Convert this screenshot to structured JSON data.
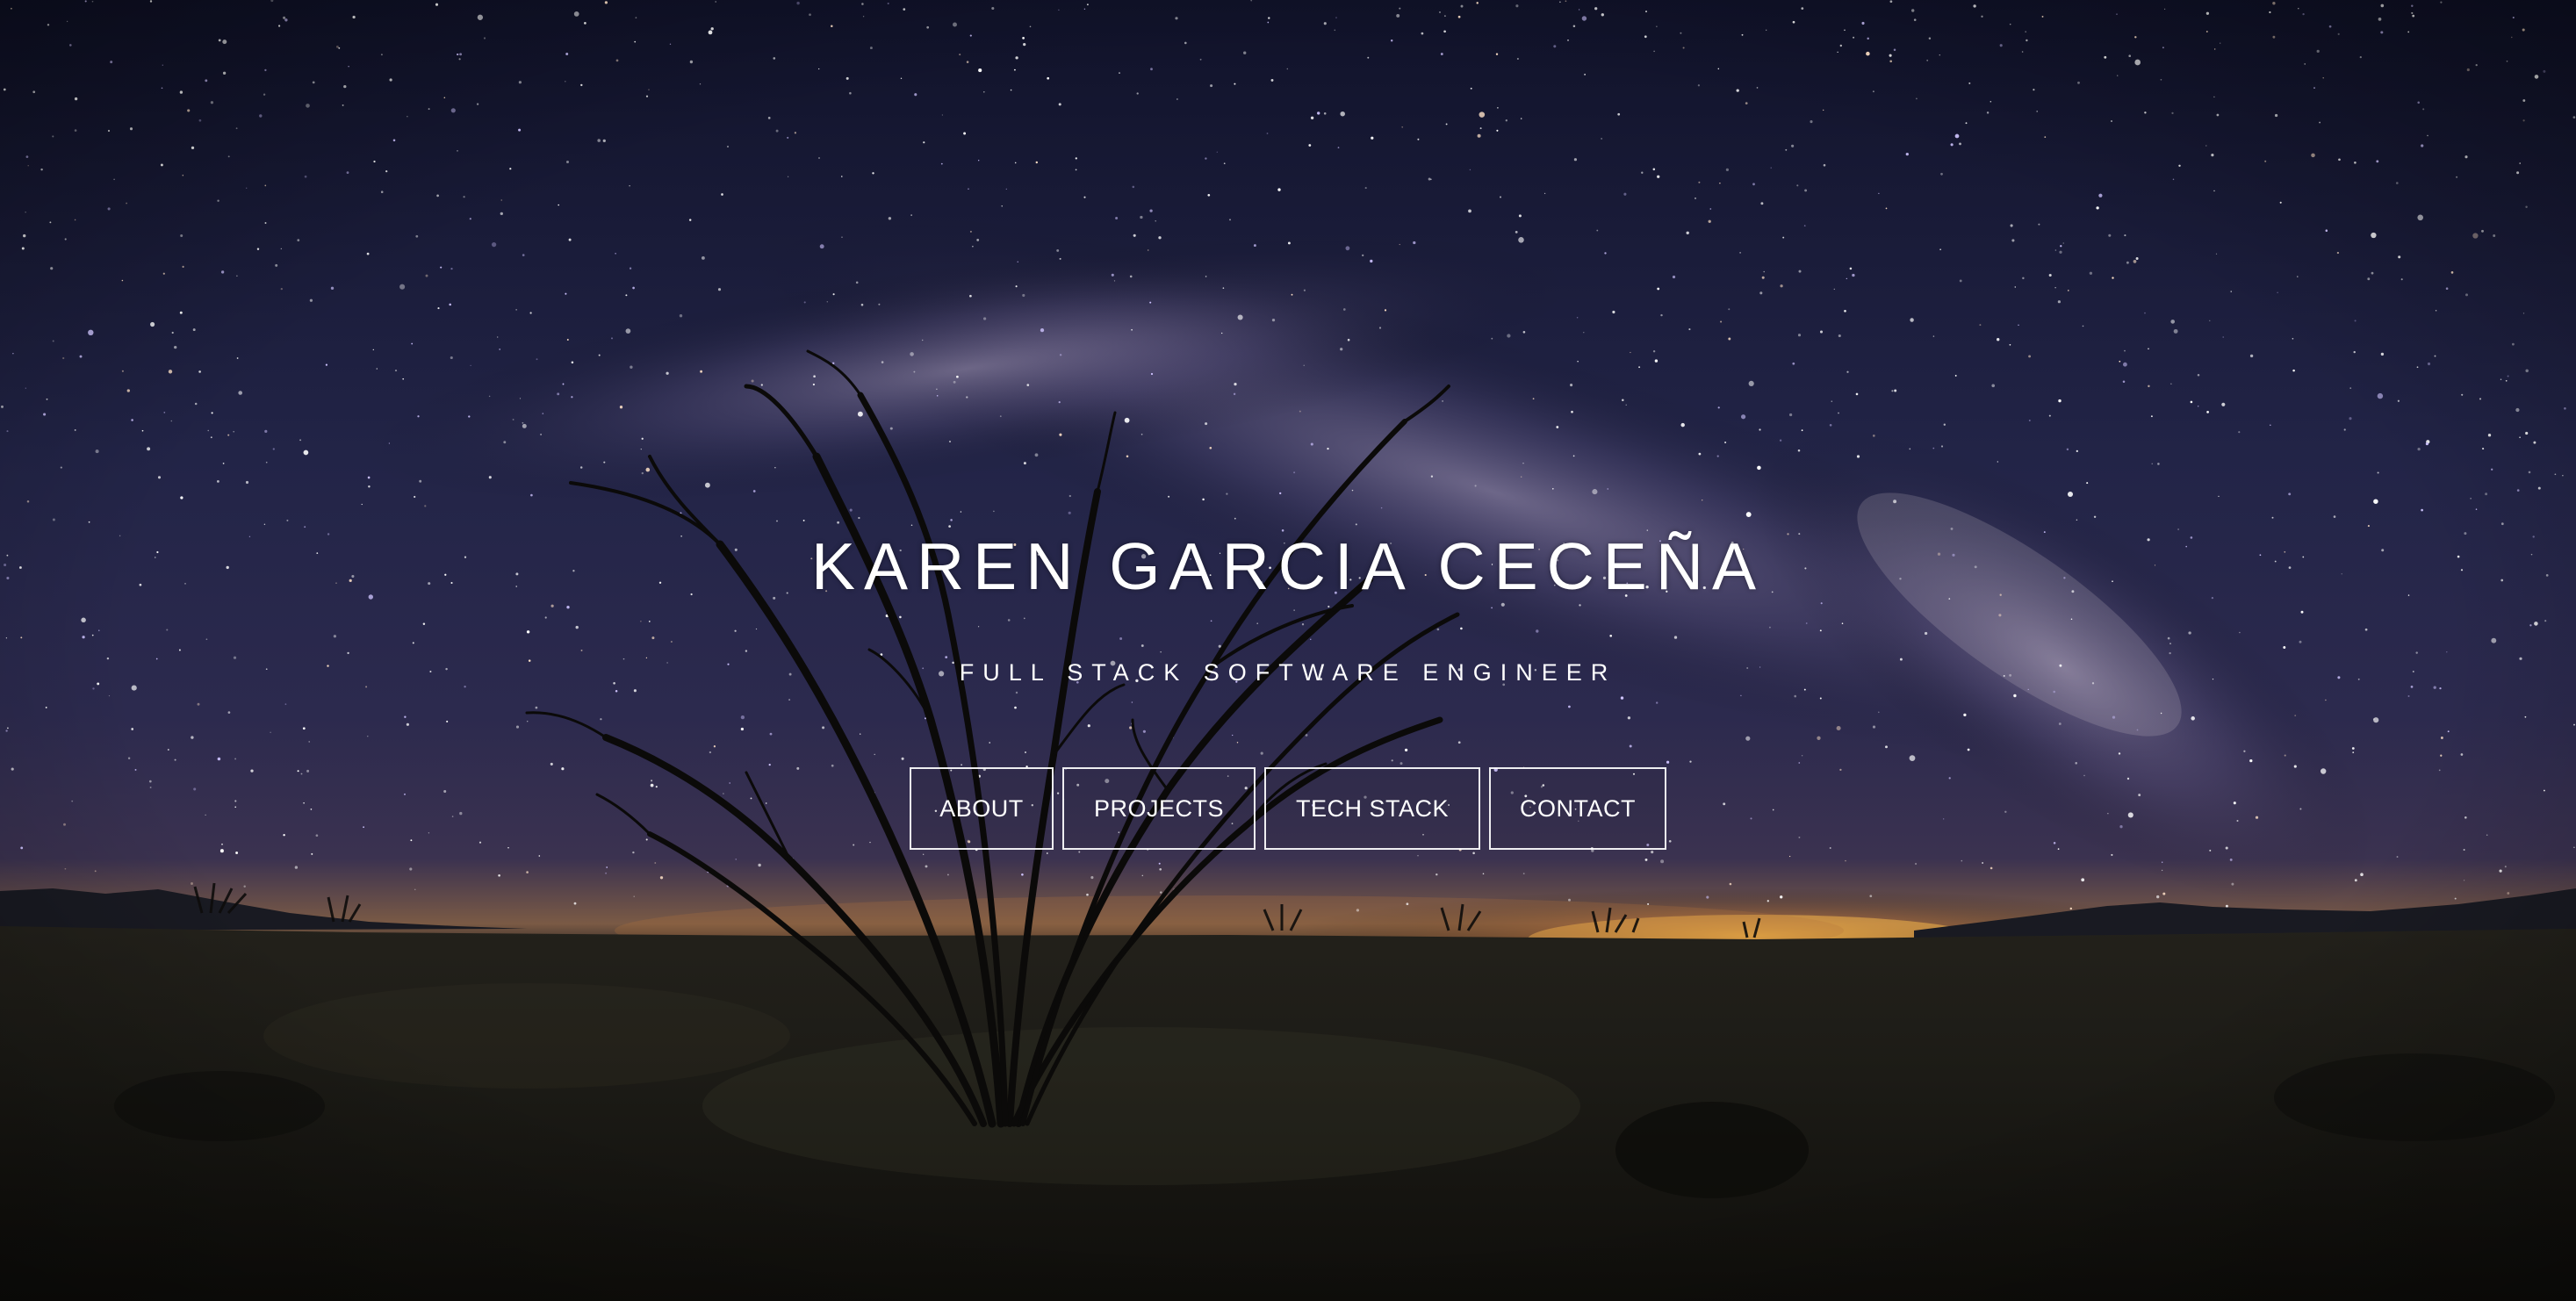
{
  "hero": {
    "name": "KAREN GARCIA CECEÑA",
    "subtitle": "FULL STACK SOFTWARE ENGINEER"
  },
  "nav": {
    "about_label": "ABOUT",
    "projects_label": "PROJECTS",
    "tech_stack_label": "TECH STACK",
    "contact_label": "CONTACT"
  },
  "colors": {
    "text": "#ffffff",
    "sky_top": "#12142c",
    "sky_mid": "#2a2a52",
    "horizon_glow": "#d99a3a",
    "ground": "#1a1a14"
  }
}
